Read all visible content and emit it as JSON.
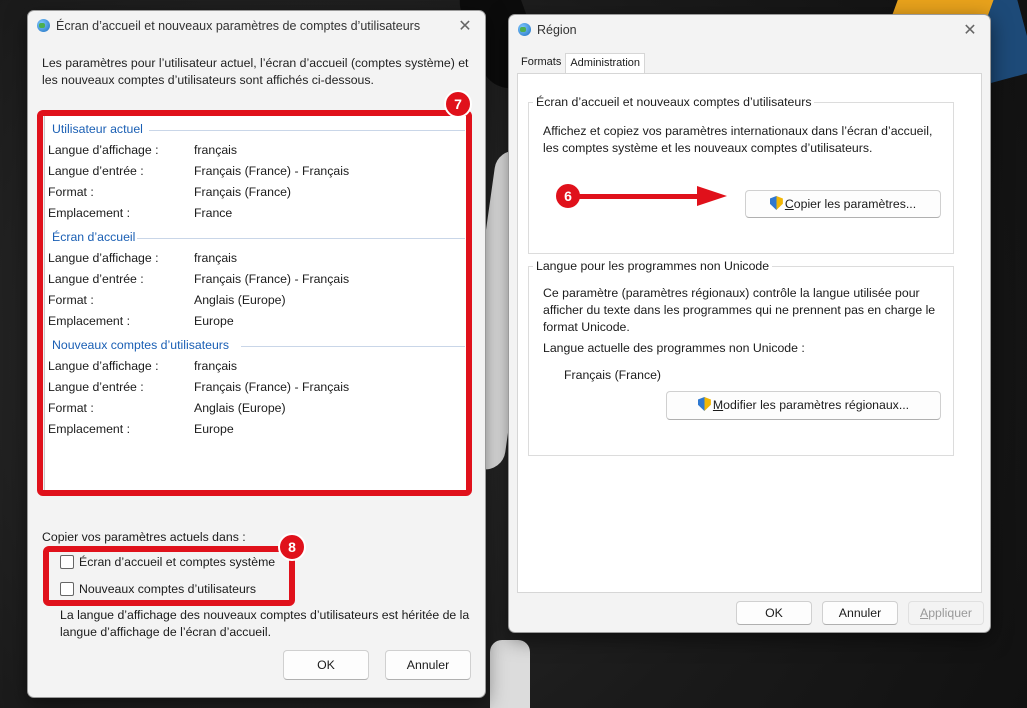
{
  "left_dialog": {
    "title": "Écran d’accueil et nouveaux paramètres de comptes d’utilisateurs",
    "intro": "Les paramètres pour l’utilisateur actuel, l’écran d’accueil (comptes système) et les nouveaux comptes d’utilisateurs sont affichés ci-dessous.",
    "groups": [
      {
        "heading": "Utilisateur actuel",
        "rows": [
          {
            "key": "Langue d’affichage :",
            "value": "français"
          },
          {
            "key": "Langue d’entrée :",
            "value": "Français (France) - Français"
          },
          {
            "key": "Format :",
            "value": "Français (France)"
          },
          {
            "key": "Emplacement :",
            "value": "France"
          }
        ]
      },
      {
        "heading": "Écran d’accueil",
        "rows": [
          {
            "key": "Langue d’affichage :",
            "value": "français"
          },
          {
            "key": "Langue d’entrée :",
            "value": "Français (France) - Français"
          },
          {
            "key": "Format :",
            "value": "Anglais (Europe)"
          },
          {
            "key": "Emplacement :",
            "value": "Europe"
          }
        ]
      },
      {
        "heading": "Nouveaux comptes d’utilisateurs",
        "rows": [
          {
            "key": "Langue d’affichage :",
            "value": "français"
          },
          {
            "key": "Langue d’entrée :",
            "value": "Français (France) - Français"
          },
          {
            "key": "Format :",
            "value": "Anglais (Europe)"
          },
          {
            "key": "Emplacement :",
            "value": "Europe"
          }
        ]
      }
    ],
    "copy_label": "Copier vos paramètres actuels dans :",
    "checkbox_welcome": "Écran d’accueil et comptes système",
    "checkbox_new_accounts": "Nouveaux comptes d’utilisateurs",
    "note": "La langue d’affichage des nouveaux comptes d’utilisateurs est héritée de la langue d’affichage de l’écran d’accueil.",
    "ok_label": "OK",
    "cancel_label": "Annuler",
    "badge_7": "7",
    "badge_8": "8"
  },
  "right_dialog": {
    "title": "Région",
    "tabs": [
      {
        "label": "Formats",
        "active": false
      },
      {
        "label": "Administration",
        "active": true
      }
    ],
    "welcome_group": {
      "title": "Écran d’accueil et nouveaux comptes d’utilisateurs",
      "text": "Affichez et copiez vos paramètres internationaux dans l’écran d’accueil, les comptes système et les nouveaux comptes d’utilisateurs.",
      "copy_button_accel": "C",
      "copy_button_rest": "opier les paramètres..."
    },
    "unicode_group": {
      "title": "Langue pour les programmes non Unicode",
      "text": "Ce paramètre (paramètres régionaux) contrôle la langue utilisée pour afficher du texte dans les programmes qui ne prennent pas en charge le format Unicode.",
      "current_label": "Langue actuelle des programmes non Unicode :",
      "current_value": "Français (France)",
      "modify_button_accel": "M",
      "modify_button_rest": "odifier les paramètres régionaux..."
    },
    "ok_label": "OK",
    "cancel_label": "Annuler",
    "apply_label_accel": "A",
    "apply_label_rest": "ppliquer",
    "badge_6": "6"
  },
  "colors": {
    "annotation_red": "#e0111b",
    "group_heading_blue": "#1a5fb4"
  },
  "icons": [
    "globe-icon",
    "close-icon",
    "shield-icon",
    "checkbox-icon",
    "arrow-icon"
  ]
}
